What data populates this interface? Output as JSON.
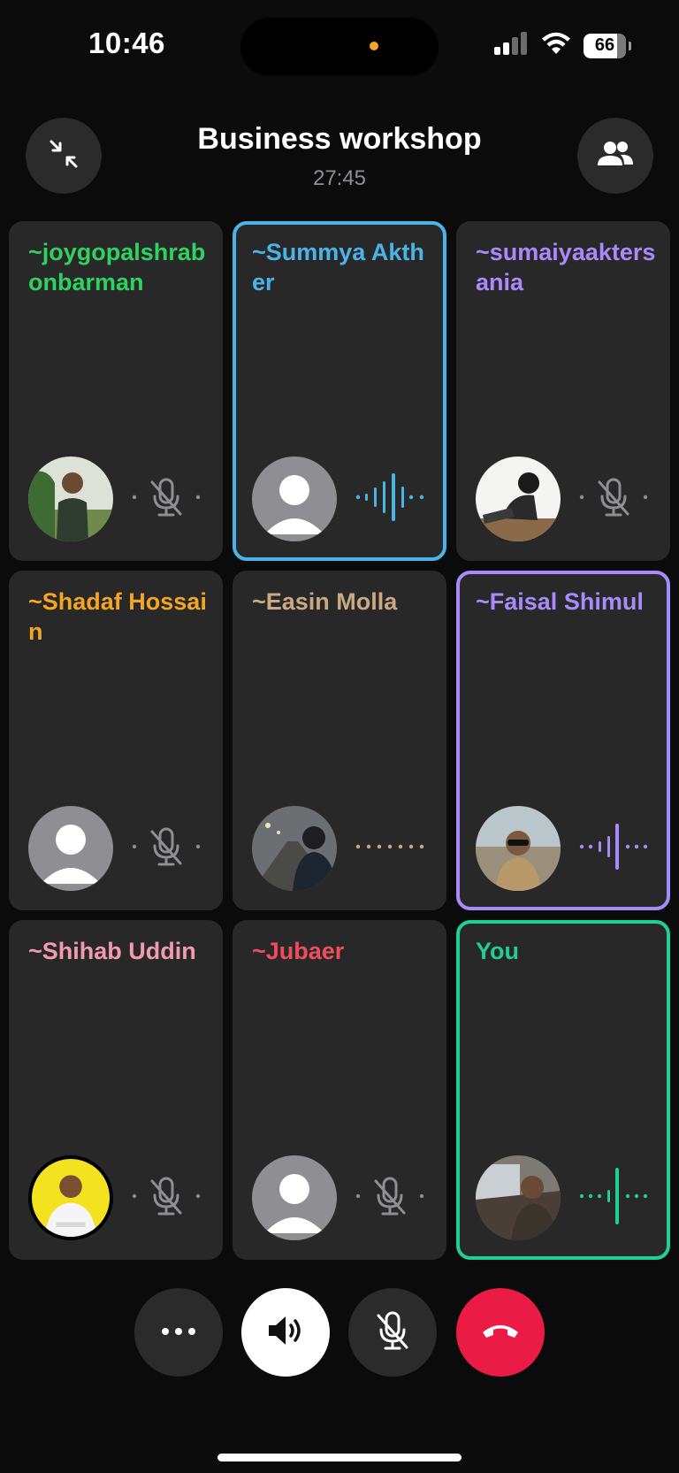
{
  "status_bar": {
    "time": "10:46",
    "battery": "66",
    "icons": [
      "signal-icon",
      "wifi-icon",
      "battery-icon"
    ]
  },
  "header": {
    "title": "Business workshop",
    "timer": "27:45",
    "left_button_icon": "minimize-icon",
    "right_button_icon": "participants-icon"
  },
  "participants": [
    {
      "name": "~joygopalshrabonbarman",
      "color": "#2fd161",
      "active": false,
      "status": "muted",
      "avatar": "photo-man-green-shirt"
    },
    {
      "name": "~Summya Akther",
      "color": "#4bb4e6",
      "active": true,
      "status": "speaking",
      "avatar": "default-avatar"
    },
    {
      "name": "~sumaiyaaktersania",
      "color": "#a78bfa",
      "active": false,
      "status": "muted",
      "avatar": "photo-woman-sitting"
    },
    {
      "name": "~Shadaf Hossain",
      "color": "#f5a524",
      "active": false,
      "status": "muted",
      "avatar": "default-avatar"
    },
    {
      "name": "~Easin Molla",
      "color": "#c9a982",
      "active": false,
      "status": "connecting",
      "avatar": "photo-man-road"
    },
    {
      "name": "~Faisal Shimul",
      "color": "#a78bfa",
      "active": true,
      "status": "speaking",
      "avatar": "photo-man-sunglasses"
    },
    {
      "name": "~Shihab Uddin",
      "color": "#f19ab3",
      "active": false,
      "status": "muted",
      "avatar": "photo-man-yellow-bg"
    },
    {
      "name": "~Jubaer",
      "color": "#f04c5c",
      "active": false,
      "status": "muted",
      "avatar": "default-avatar"
    },
    {
      "name": "You",
      "color": "#1fcf96",
      "active": true,
      "status": "speaking",
      "avatar": "photo-man-car"
    }
  ],
  "controls": [
    {
      "name": "more-button",
      "icon": "more-icon"
    },
    {
      "name": "speaker-button",
      "icon": "speaker-icon"
    },
    {
      "name": "mute-button",
      "icon": "mic-off-icon"
    },
    {
      "name": "end-call-button",
      "icon": "end-call-icon"
    }
  ],
  "colors": {
    "background": "#0b0b0b",
    "tile": "#282828",
    "end_call": "#ea1c45",
    "muted_icon": "#8e8e93"
  }
}
